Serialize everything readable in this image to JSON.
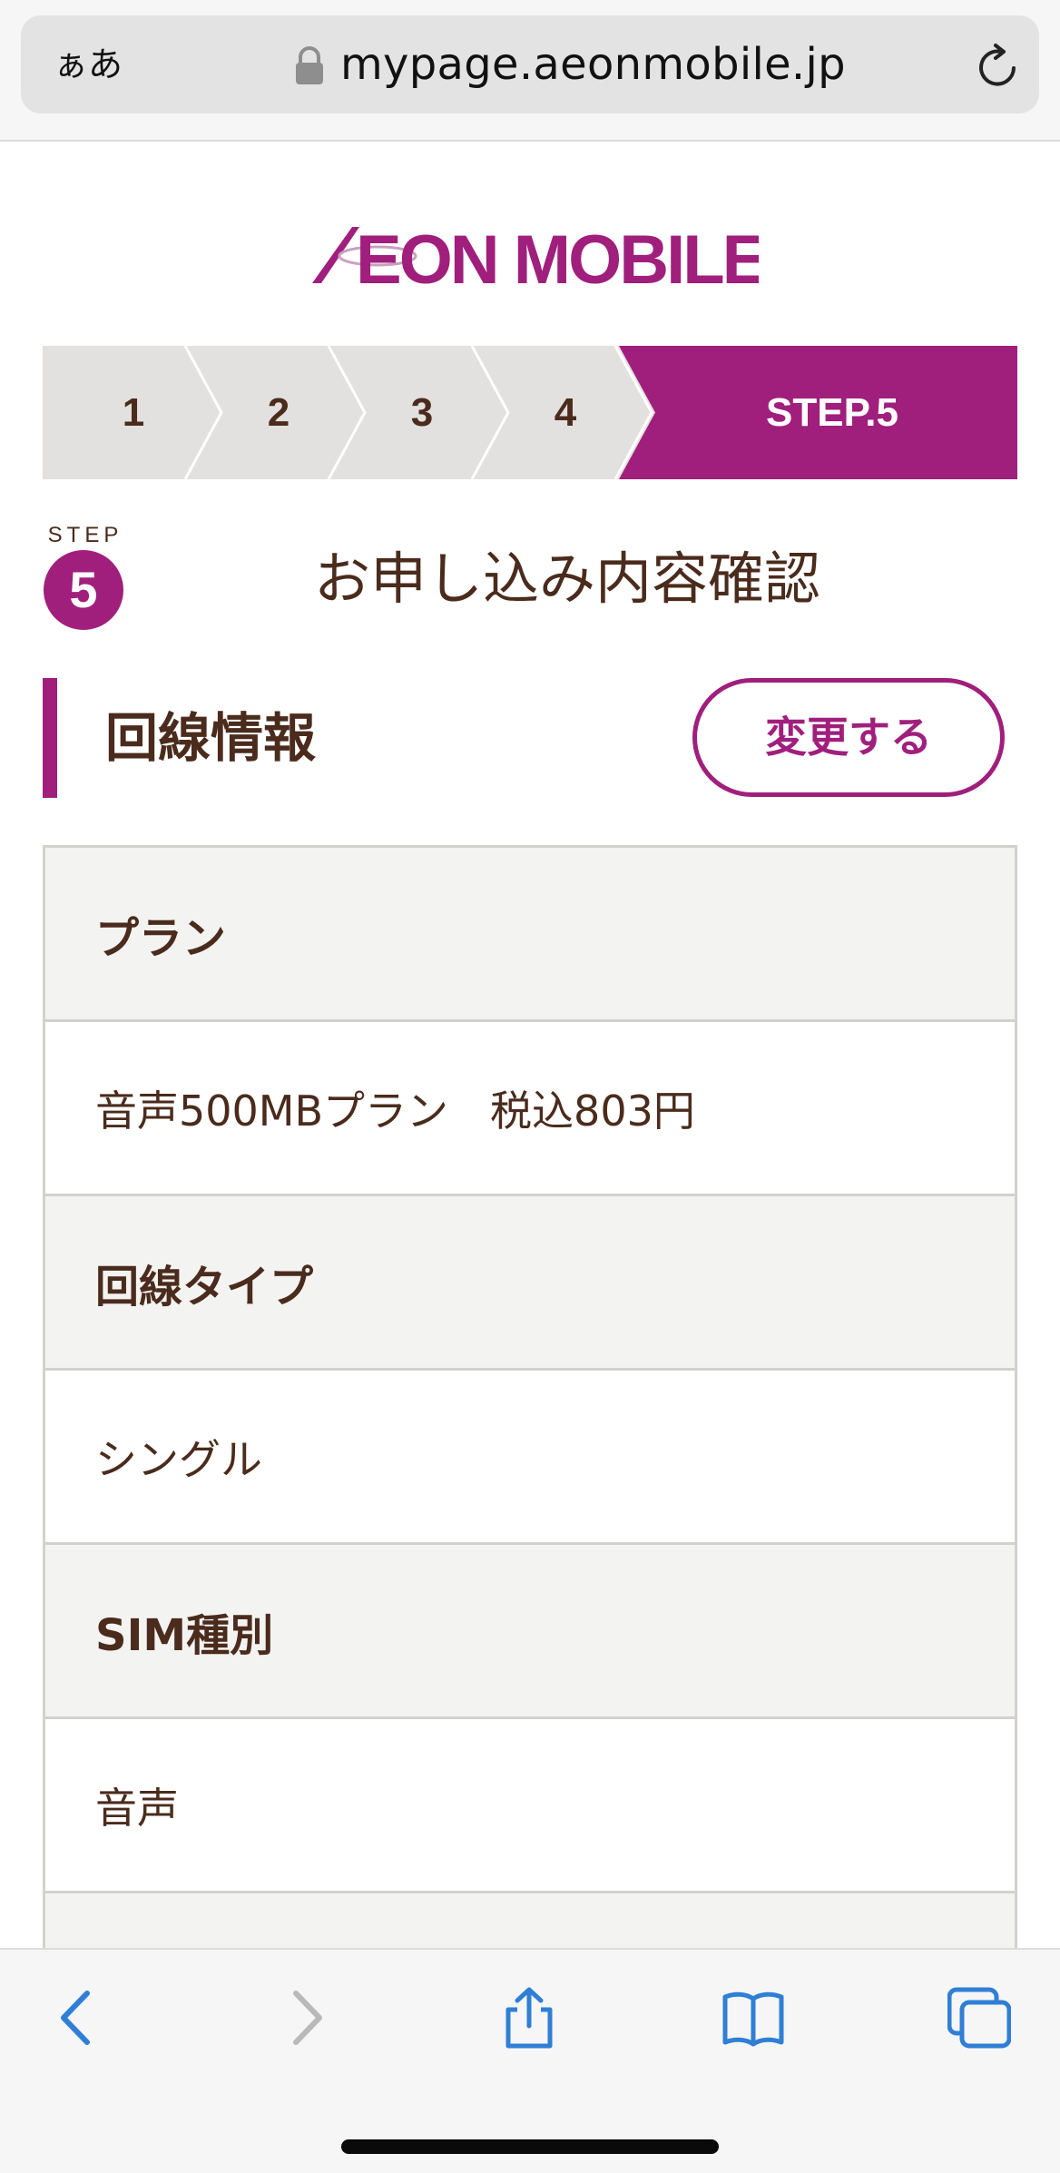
{
  "browser": {
    "aa_label": "ぁあ",
    "url": "mypage.aeonmobile.jp",
    "lock_icon": "lock-icon",
    "reload_icon": "reload-icon"
  },
  "logo": {
    "text_ae": "Æ",
    "text_rest": "ON MOBILE",
    "color": "#a01f7c"
  },
  "stepper": {
    "steps": [
      "1",
      "2",
      "3",
      "4",
      "STEP.5"
    ],
    "active_index": 4,
    "active_color": "#a01f7c",
    "inactive_color": "#e2e1df"
  },
  "step_heading": {
    "badge_label": "STEP",
    "badge_number": "5",
    "title": "お申し込み内容確認"
  },
  "section": {
    "title": "回線情報",
    "change_button": "変更する"
  },
  "table": {
    "rows": [
      {
        "label": "プラン",
        "value": "音声500MBプラン　税込803円"
      },
      {
        "label": "回線タイプ",
        "value": "シングル"
      },
      {
        "label": "SIM種別",
        "value": "音声"
      }
    ]
  },
  "toolbar": {
    "icons": [
      "back-icon",
      "forward-icon",
      "share-icon",
      "bookmarks-icon",
      "tabs-icon"
    ],
    "accent": "#2f7fd6"
  },
  "colors": {
    "brand": "#a01f7c",
    "text_brown": "#4a2b1c"
  }
}
